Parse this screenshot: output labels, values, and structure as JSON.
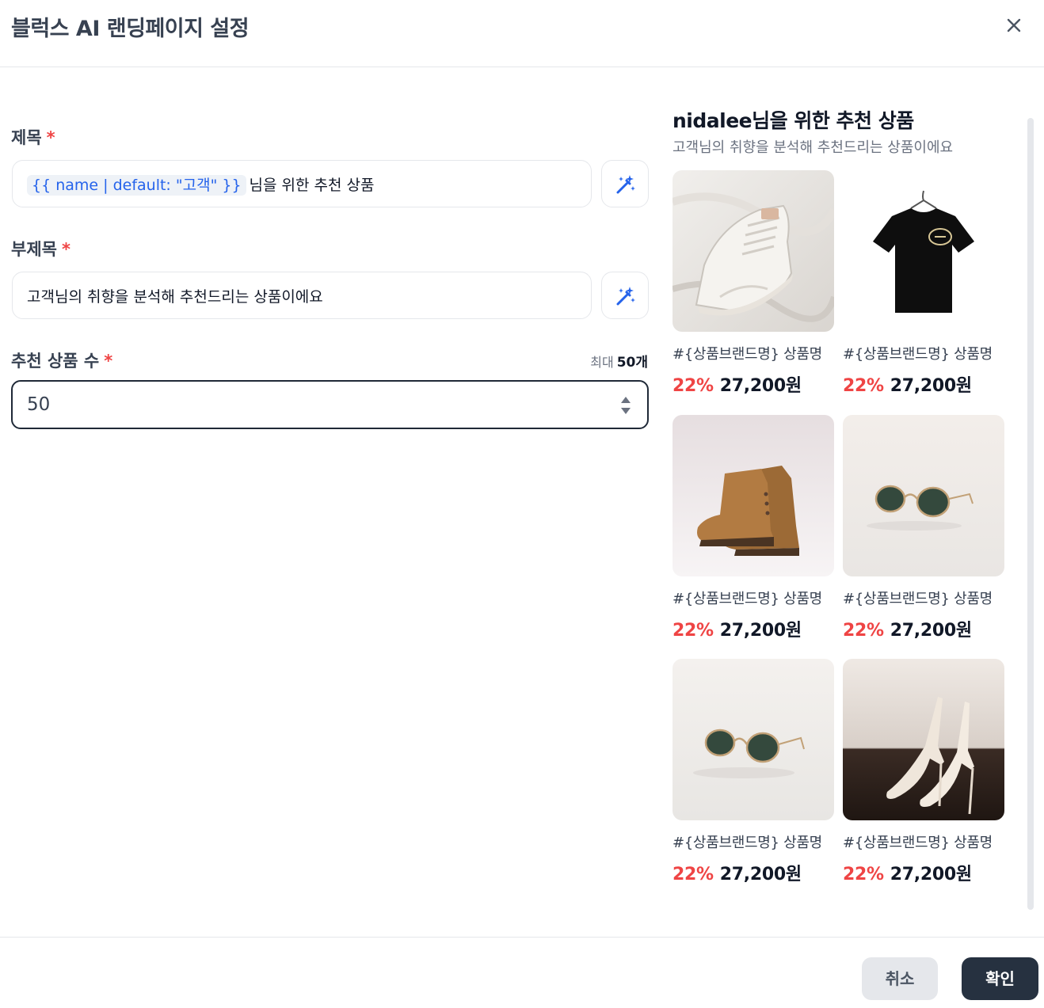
{
  "dialog": {
    "title": "블럭스 AI 랜딩페이지 설정",
    "close_icon": "close-icon"
  },
  "form": {
    "title_field": {
      "label": "제목",
      "required_mark": "*",
      "token": "{{ name | default: \"고객\" }}",
      "value": "님을 위한 추천 상품",
      "ai_icon": "magic-wand-icon"
    },
    "subtitle_field": {
      "label": "부제목",
      "required_mark": "*",
      "value": "고객님의 취향을 분석해 추천드리는 상품이에요",
      "ai_icon": "magic-wand-icon"
    },
    "count_field": {
      "label": "추천 상품 수",
      "required_mark": "*",
      "max_label": "최대",
      "max_value": "50개",
      "value": "50"
    }
  },
  "preview": {
    "title": "nidalee님을 위한 추천 상품",
    "subtitle": "고객님의 취향을 분석해 추천드리는 상품이에요",
    "products": [
      {
        "image": "white-sneaker",
        "name": "#{상품브랜드명} 상품명",
        "discount": "22%",
        "price": "27,200원"
      },
      {
        "image": "black-tshirt",
        "name": "#{상품브랜드명} 상품명",
        "discount": "22%",
        "price": "27,200원"
      },
      {
        "image": "brown-boots",
        "name": "#{상품브랜드명} 상품명",
        "discount": "22%",
        "price": "27,200원"
      },
      {
        "image": "sunglasses",
        "name": "#{상품브랜드명} 상품명",
        "discount": "22%",
        "price": "27,200원"
      },
      {
        "image": "sunglasses",
        "name": "#{상품브랜드명} 상품명",
        "discount": "22%",
        "price": "27,200원"
      },
      {
        "image": "white-heels",
        "name": "#{상품브랜드명} 상품명",
        "discount": "22%",
        "price": "27,200원"
      }
    ]
  },
  "footer": {
    "cancel_label": "취소",
    "confirm_label": "확인"
  },
  "colors": {
    "accent": "#2563eb",
    "required": "#ef4444",
    "primary_button": "#263140"
  }
}
